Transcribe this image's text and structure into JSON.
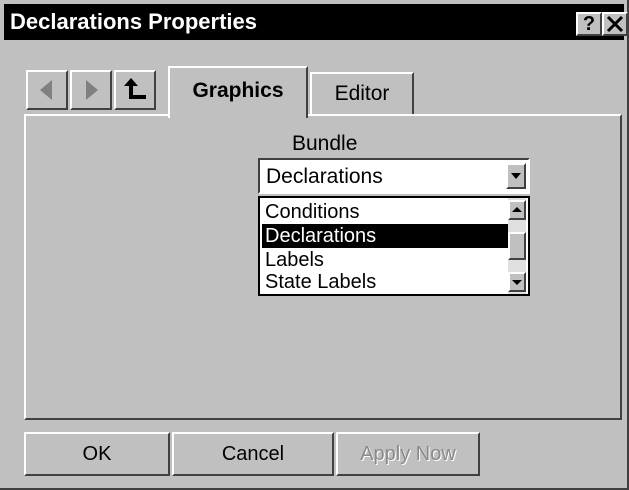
{
  "window": {
    "title": "Declarations Properties",
    "help_label": "?",
    "close_label": "✕"
  },
  "nav": {
    "back": "back-arrow-icon",
    "forward": "forward-arrow-icon",
    "up": "up-level-icon"
  },
  "tabs": [
    {
      "label": "Graphics",
      "active": true
    },
    {
      "label": "Editor",
      "active": false
    }
  ],
  "bundle": {
    "label": "Bundle",
    "selected": "Declarations",
    "options": [
      "Conditions",
      "Declarations",
      "Labels",
      "State Labels"
    ]
  },
  "buttons": {
    "ok": "OK",
    "cancel": "Cancel",
    "apply": "Apply Now"
  },
  "colors": {
    "face": "#c0c0c0",
    "titlebar": "#000000",
    "selection": "#000000"
  }
}
